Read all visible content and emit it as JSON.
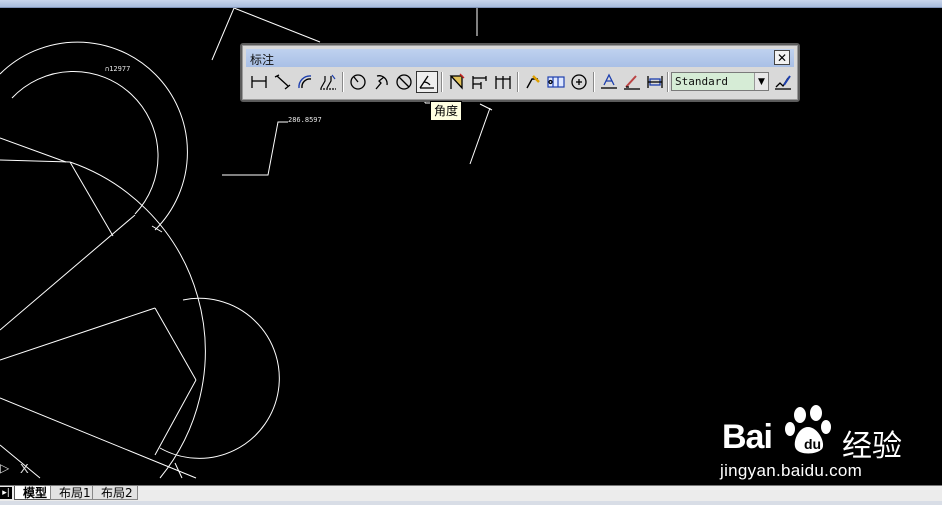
{
  "toolbar": {
    "title": "标注",
    "close_glyph": "✕",
    "buttons": [
      {
        "name": "linear-dimension-icon"
      },
      {
        "name": "aligned-dimension-icon"
      },
      {
        "name": "arc-length-icon"
      },
      {
        "name": "ordinate-dimension-icon"
      },
      {
        "name": "radius-dimension-icon"
      },
      {
        "name": "jogged-dimension-icon"
      },
      {
        "name": "diameter-dimension-icon"
      },
      {
        "name": "angular-dimension-icon"
      },
      {
        "name": "quick-dimension-icon"
      },
      {
        "name": "baseline-dimension-icon"
      },
      {
        "name": "continue-dimension-icon"
      },
      {
        "name": "quick-leader-icon"
      },
      {
        "name": "tolerance-icon"
      },
      {
        "name": "center-mark-icon"
      },
      {
        "name": "dimension-edit-icon"
      },
      {
        "name": "dimension-text-edit-icon"
      },
      {
        "name": "dimension-update-icon"
      },
      {
        "name": "dimension-style-icon"
      }
    ],
    "style_select_value": "Standard",
    "style_select_arrow": "▼",
    "pressed_button": "angular-dimension-icon"
  },
  "tooltip": {
    "text": "角度"
  },
  "drawing": {
    "dim_text_1": "∩12977",
    "dim_text_2": "286.8597",
    "ucs_label": "X",
    "ucs_arrow": "▷",
    "line_color": "#ffffff",
    "background": "#000000"
  },
  "tabs": {
    "nav_glyph": "▸|",
    "items": [
      {
        "label": "模型",
        "active": true
      },
      {
        "label": "布局1",
        "active": false
      },
      {
        "label": "布局2",
        "active": false
      }
    ]
  },
  "watermark": {
    "brand": "Bai",
    "brand_suffix": "du",
    "cn": "经验",
    "url": "jingyan.baidu.com"
  }
}
